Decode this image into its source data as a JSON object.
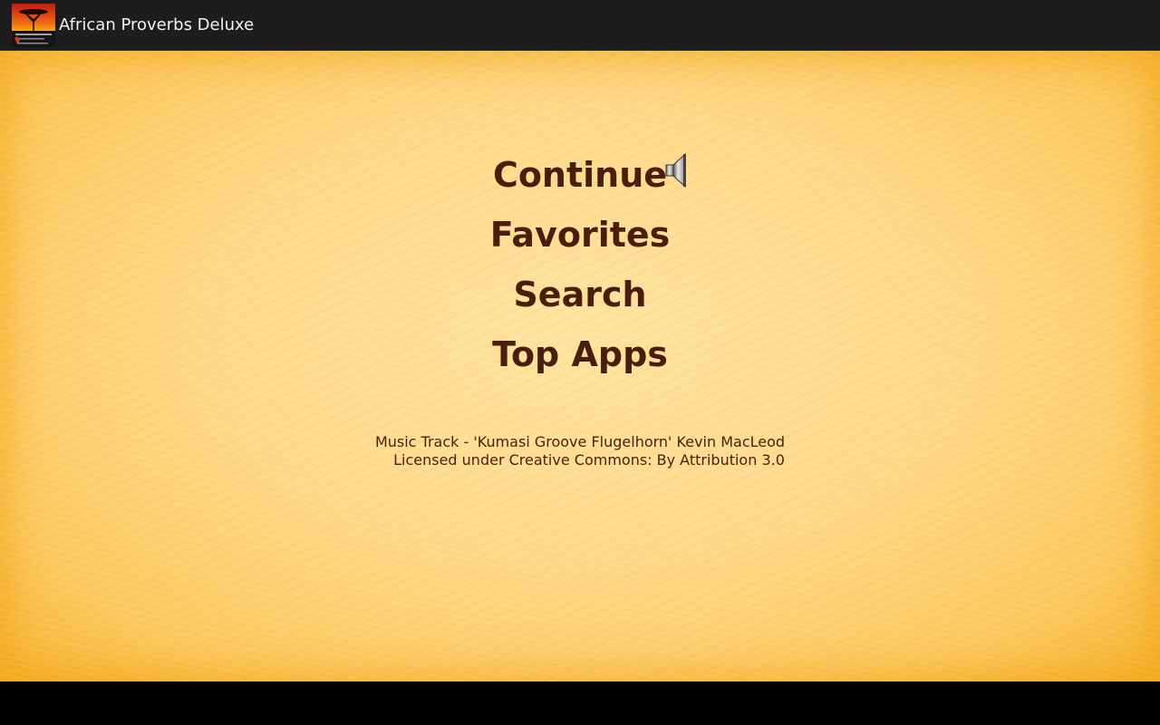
{
  "app": {
    "title": "African Proverbs Deluxe",
    "icon": "app-logo-icon"
  },
  "menu": {
    "continue_label": "Continue",
    "favorites_label": "Favorites",
    "search_label": "Search",
    "top_apps_label": "Top Apps",
    "sound_icon": "speaker-icon"
  },
  "credits": {
    "line1": "Music Track - 'Kumasi Groove Flugelhorn' Kevin MacLeod",
    "line2": "Licensed under Creative Commons: By Attribution 3.0"
  },
  "colors": {
    "accent_text": "#4a1e0c",
    "background": "#ffd98a",
    "actionbar": "#1d1d1d"
  }
}
